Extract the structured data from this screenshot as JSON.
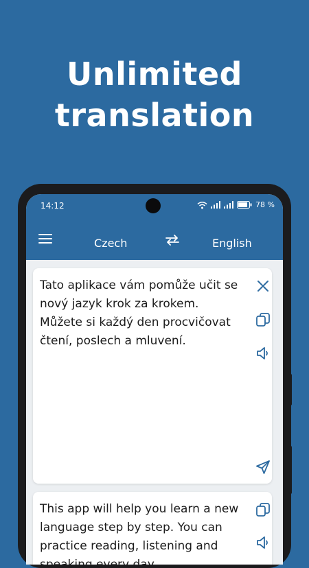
{
  "headline": {
    "line1": "Unlimited",
    "line2": "translation"
  },
  "status_bar": {
    "time": "14:12",
    "battery": "78 %",
    "icons": [
      "wifi-icon",
      "signal-icon",
      "signal-icon",
      "battery-icon"
    ]
  },
  "app_bar": {
    "menu_icon": "hamburger-menu-icon",
    "source_language": "Czech",
    "swap_icon": "swap-arrows-icon",
    "target_language": "English"
  },
  "source_card": {
    "text": "Tato aplikace vám pomůže učit se nový jazyk krok za krokem. Můžete si každý den procvičovat čtení, poslech a mluvení.",
    "icons": [
      "close-icon",
      "copy-icon",
      "speaker-icon",
      "send-icon"
    ]
  },
  "target_card": {
    "text": "This app will help you learn a new language step by step. You can practice reading, listening and speaking every day.",
    "icons": [
      "copy-icon",
      "speaker-icon"
    ]
  },
  "colors": {
    "background": "#2c6aa0",
    "app_bar": "#2c6aa0",
    "icon_accent": "#2c6aa0",
    "screen_bg": "#eceff2",
    "card_bg": "#ffffff"
  }
}
